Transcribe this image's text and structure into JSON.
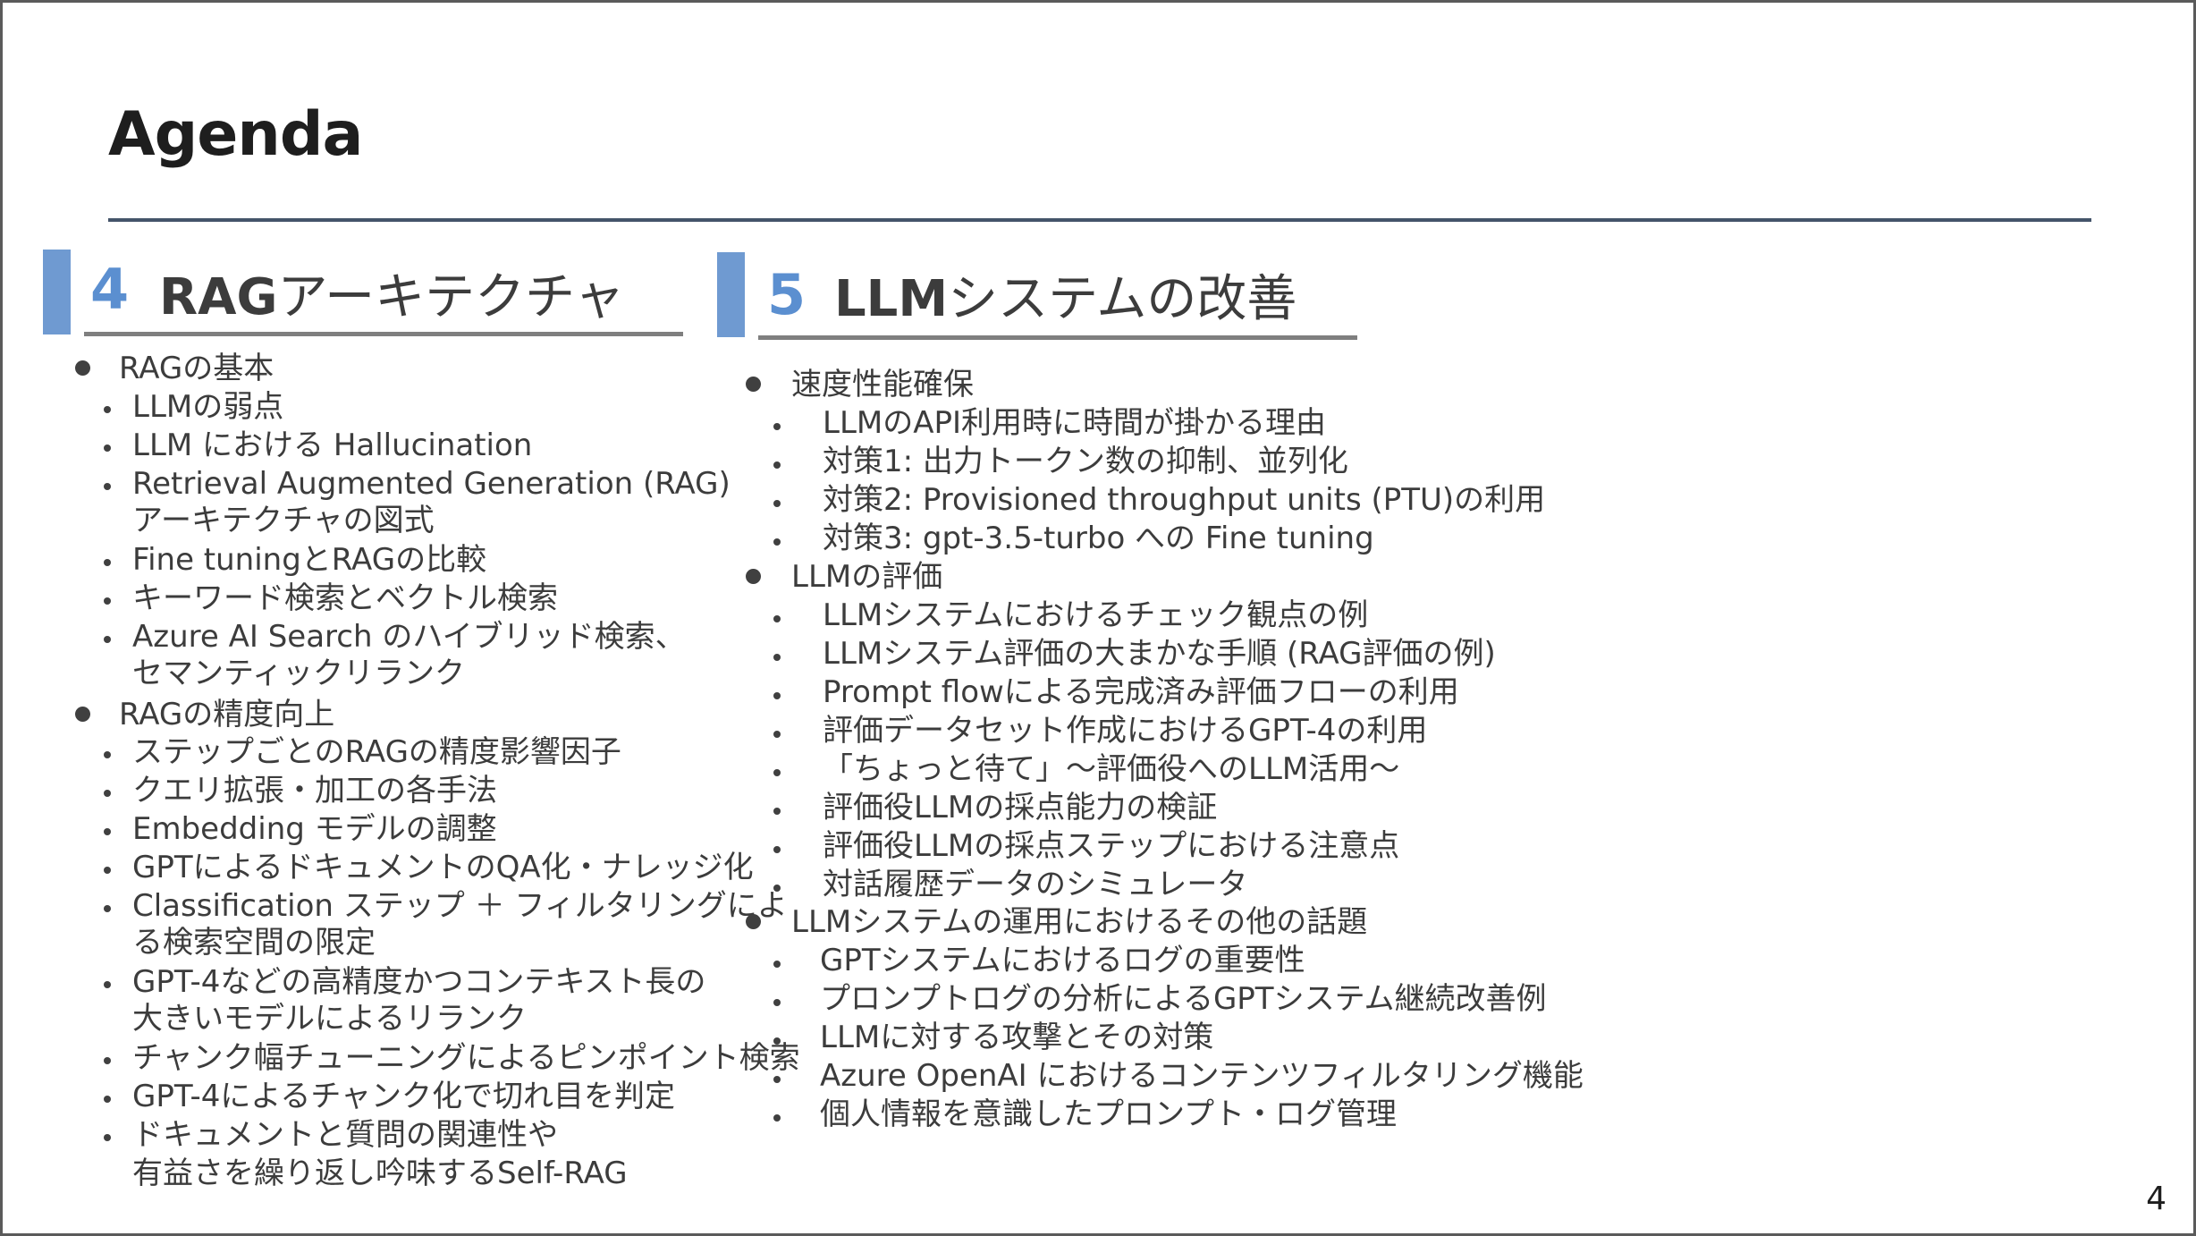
{
  "slide": {
    "title": "Agenda",
    "page_number": "4"
  },
  "section4": {
    "number": "4",
    "title_bold": "RAG",
    "title_rest": "アーキテクチャ",
    "groups": [
      {
        "heading": "RAGの基本",
        "items": [
          [
            "LLMの弱点"
          ],
          [
            "LLM における Hallucination"
          ],
          [
            "Retrieval Augmented Generation (RAG)",
            "アーキテクチャの図式"
          ],
          [
            "Fine tuningとRAGの比較"
          ],
          [
            "キーワード検索とベクトル検索"
          ],
          [
            "Azure AI Search のハイブリッド検索、",
            "セマンティックリランク"
          ]
        ]
      },
      {
        "heading": "RAGの精度向上",
        "items": [
          [
            "ステップごとのRAGの精度影響因子"
          ],
          [
            "クエリ拡張・加工の各手法"
          ],
          [
            "Embedding モデルの調整"
          ],
          [
            "GPTによるドキュメントのQA化・ナレッジ化"
          ],
          [
            "Classification ステップ ＋ フィルタリングによ",
            "る検索空間の限定"
          ],
          [
            "GPT-4などの高精度かつコンテキスト長の",
            "大きいモデルによるリランク"
          ],
          [
            "チャンク幅チューニングによるピンポイント検索"
          ],
          [
            "GPT-4によるチャンク化で切れ目を判定"
          ],
          [
            "ドキュメントと質問の関連性や",
            "有益さを繰り返し吟味するSelf-RAG"
          ]
        ]
      }
    ]
  },
  "section5": {
    "number": "5",
    "title_bold": "LLM",
    "title_rest": "システムの改善",
    "groups": [
      {
        "heading": "速度性能確保",
        "items": [
          "LLMのAPI利用時に時間が掛かる理由",
          "対策1: 出力トークン数の抑制、並列化",
          "対策2: Provisioned throughput units (PTU)の利用",
          "対策3: gpt-3.5-turbo への Fine tuning"
        ]
      },
      {
        "heading": "LLMの評価",
        "items": [
          "LLMシステムにおけるチェック観点の例",
          "LLMシステム評価の大まかな手順 (RAG評価の例)",
          "Prompt flowによる完成済み評価フローの利用",
          "評価データセット作成におけるGPT-4の利用",
          "「ちょっと待て」〜評価役へのLLM活用〜",
          "評価役LLMの採点能力の検証",
          "評価役LLMの採点ステップにおける注意点",
          "対話履歴データのシミュレータ"
        ]
      },
      {
        "heading": "LLMシステムの運用におけるその他の話題",
        "items": [
          "GPTシステムにおけるログの重要性",
          "プロンプトログの分析によるGPTシステム継続改善例",
          "LLMに対する攻撃とその対策",
          "Azure OpenAI におけるコンテンツフィルタリング機能",
          "個人情報を意識したプロンプト・ログ管理"
        ]
      }
    ]
  }
}
